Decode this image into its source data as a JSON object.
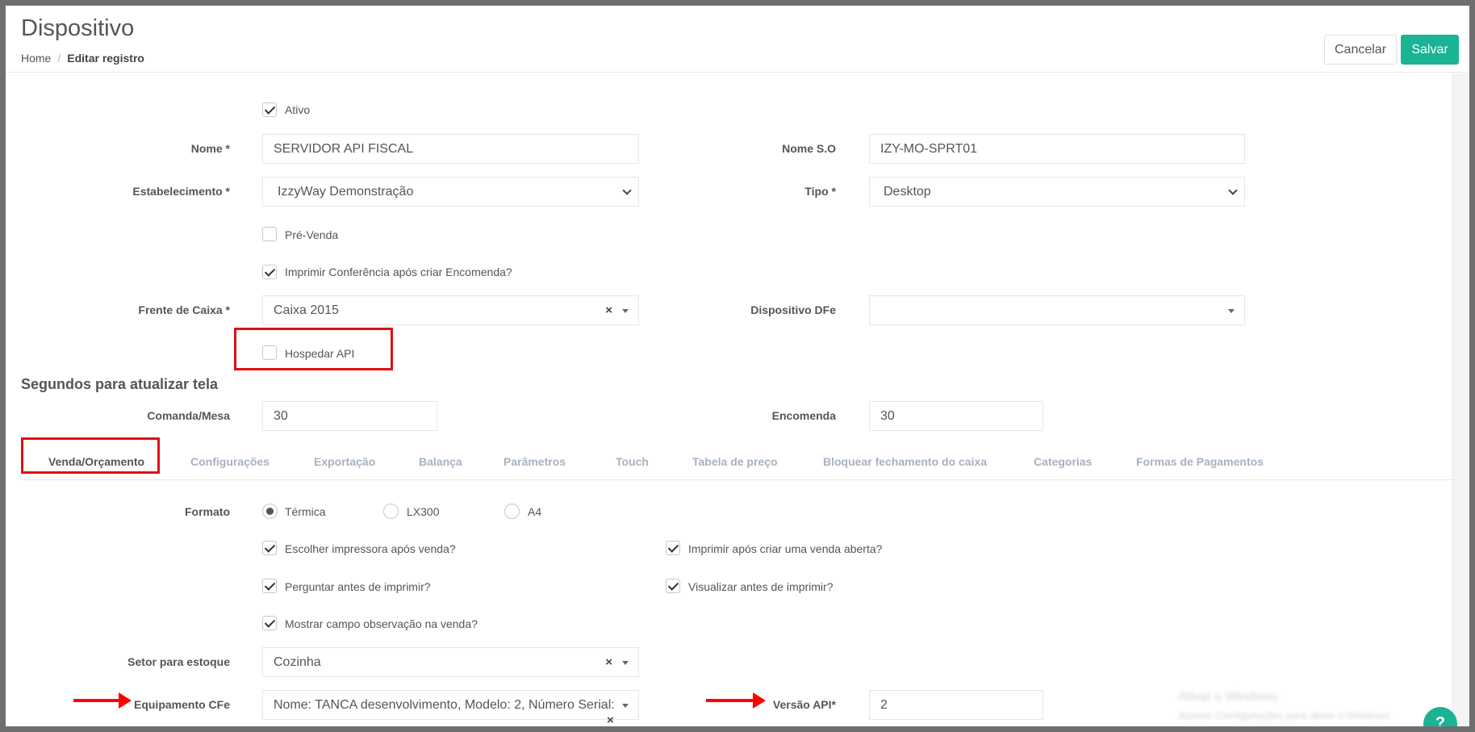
{
  "header": {
    "title": "Dispositivo",
    "breadcrumb_home": "Home",
    "breadcrumb_separator": "/",
    "breadcrumb_current": "Editar registro",
    "cancel_label": "Cancelar",
    "save_label": "Salvar"
  },
  "form": {
    "ativo_label": "Ativo",
    "ativo_checked": true,
    "nome_label": "Nome *",
    "nome_value": "SERVIDOR API FISCAL",
    "nome_so_label": "Nome S.O",
    "nome_so_value": "IZY-MO-SPRT01",
    "estabelecimento_label": "Estabelecimento *",
    "estabelecimento_value": "IzzyWay Demonstração",
    "tipo_label": "Tipo *",
    "tipo_value": "Desktop",
    "pre_venda_label": "Pré-Venda",
    "imprimir_conferencia_label": "Imprimir Conferência após criar Encomenda?",
    "frente_caixa_label": "Frente de Caixa *",
    "frente_caixa_value": "Caixa 2015",
    "dispositivo_dfe_label": "Dispositivo DFe",
    "dispositivo_dfe_value": "",
    "hospedar_api_label": "Hospedar API",
    "segundos_title": "Segundos para atualizar tela",
    "comanda_mesa_label": "Comanda/Mesa",
    "comanda_mesa_value": "30",
    "encomenda_label": "Encomenda",
    "encomenda_value": "30"
  },
  "tabs": [
    {
      "label": "Venda/Orçamento",
      "active": true
    },
    {
      "label": "Configurações"
    },
    {
      "label": "Exportação"
    },
    {
      "label": "Balança"
    },
    {
      "label": "Parâmetros"
    },
    {
      "label": "Touch"
    },
    {
      "label": "Tabela de preço"
    },
    {
      "label": "Bloquear fechamento do caixa"
    },
    {
      "label": "Categorias"
    },
    {
      "label": "Formas de Pagamentos"
    }
  ],
  "venda": {
    "formato_label": "Formato",
    "formato_options": [
      "Térmica",
      "LX300",
      "A4"
    ],
    "formato_selected": "Térmica",
    "escolher_impressora_label": "Escolher impressora após venda?",
    "imprimir_venda_aberta_label": "Imprimir após criar uma venda aberta?",
    "perguntar_label": "Perguntar antes de imprimir?",
    "visualizar_label": "Visualizar antes de imprimir?",
    "mostrar_obs_label": "Mostrar campo observação na venda?",
    "setor_label": "Setor para estoque",
    "setor_value": "Cozinha",
    "equipamento_label": "Equipamento CFe",
    "equipamento_value": "Nome: TANCA desenvolvimento, Modelo: 2, Número Serial:",
    "versao_api_label": "Versão API*",
    "versao_api_value": "2"
  },
  "watermark": {
    "line1": "Ativar o Windows",
    "line2": "Acesse Configurações para ativar o Windows."
  },
  "help_glyph": "?",
  "colors": {
    "accent": "#1ab394",
    "highlight": "#e01010"
  }
}
